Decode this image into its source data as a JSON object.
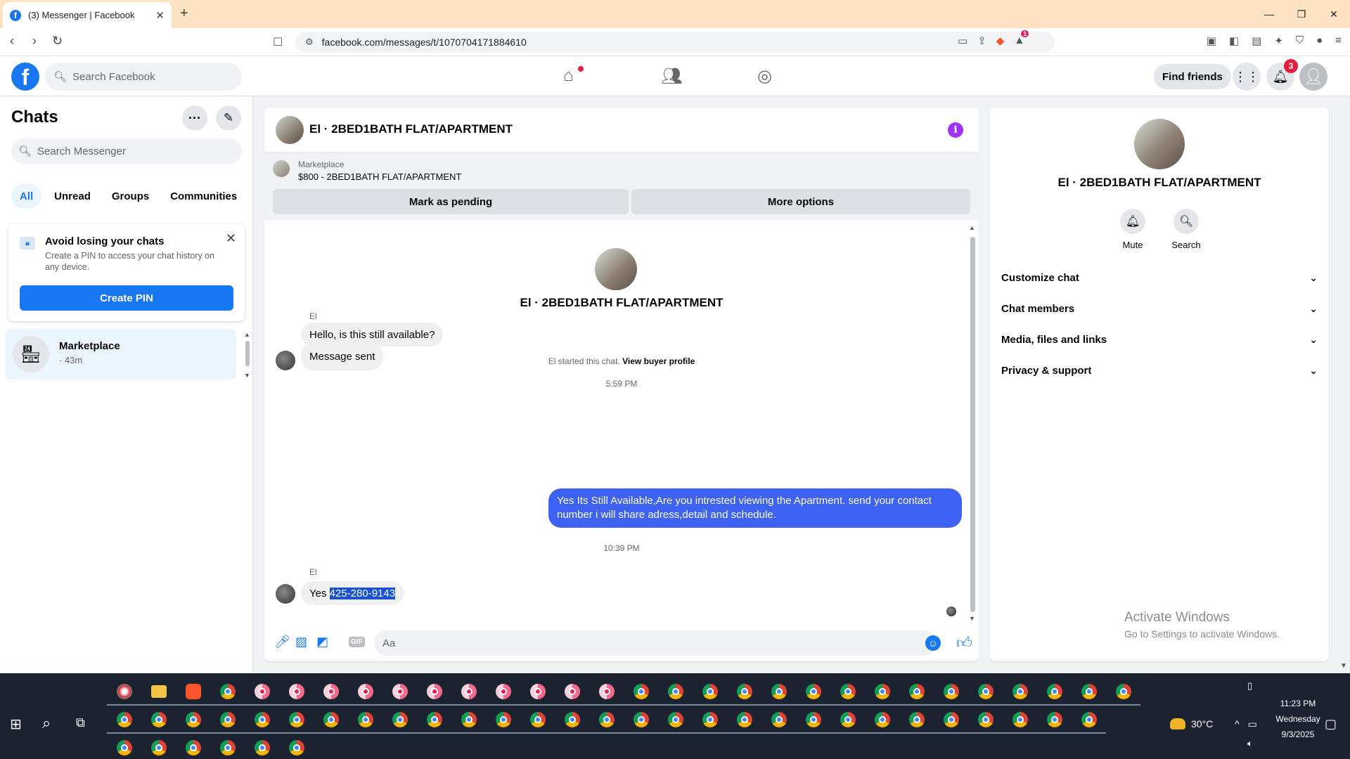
{
  "browser": {
    "tab_title": "(3) Messenger | Facebook",
    "url": "facebook.com/messages/t/1070704171884610",
    "extension_badge": "1"
  },
  "fb": {
    "search_placeholder": "Search Facebook",
    "find_friends": "Find friends",
    "notifications_count": "3"
  },
  "left": {
    "title": "Chats",
    "search_placeholder": "Search Messenger",
    "filters": [
      "All",
      "Unread",
      "Groups",
      "Communities"
    ],
    "pin_card": {
      "title": "Avoid losing your chats",
      "text": "Create a PIN to access your chat history on any device.",
      "button": "Create PIN"
    },
    "chat_item": {
      "name": "Marketplace",
      "time": "· 43m"
    }
  },
  "convo": {
    "title": "El · 2BED1BATH FLAT/APARTMENT",
    "marketplace_label": "Marketplace",
    "marketplace_item": "$800 - 2BED1BATH FLAT/APARTMENT",
    "btn_pending": "Mark as pending",
    "btn_more": "More options",
    "started_text": "El started this chat.",
    "started_link": "View buyer profile",
    "sender": "El",
    "msg1": "Hello, is this still available?",
    "msg2": "Message sent",
    "time1": "5:59 PM",
    "msg_out": "Yes Its Still Available,Are you intrested viewing the Apartment. send your contact number i will share adress,detail and schedule.",
    "time2": "10:39 PM",
    "msg3_prefix": "Yes",
    "msg3_phone": "425-280-9143",
    "input_placeholder": "Aa"
  },
  "right": {
    "name": "El · 2BED1BATH FLAT/APARTMENT",
    "mute": "Mute",
    "search": "Search",
    "rows": [
      "Customize chat",
      "Chat members",
      "Media, files and links",
      "Privacy & support"
    ]
  },
  "windows": {
    "activate_title": "Activate Windows",
    "activate_sub": "Go to Settings to activate Windows.",
    "temperature": "30°C",
    "time": "11:23 PM",
    "day": "Wednesday",
    "date": "9/3/2025"
  },
  "colors": {
    "fb_blue": "#1877f2",
    "outgoing_bubble": "#3e63f4",
    "info_purple": "#a033ff"
  }
}
